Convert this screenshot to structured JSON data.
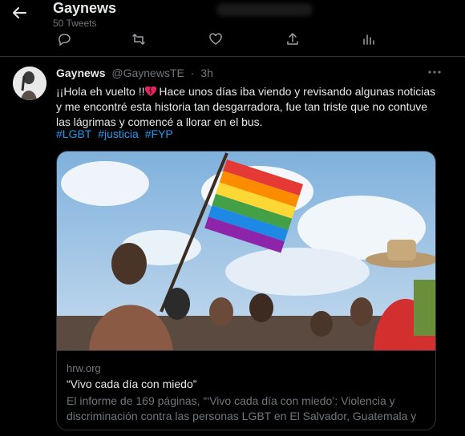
{
  "header": {
    "title": "Gaynews",
    "tweet_count": "50 Tweets"
  },
  "icons": {
    "back": "arrow-left-icon",
    "reply": "reply-icon",
    "retweet": "retweet-icon",
    "like": "heart-icon",
    "share": "share-icon",
    "analytics": "analytics-icon",
    "more": "more-icon"
  },
  "tweet": {
    "author_name": "Gaynews",
    "author_handle": "@GaynewsTE",
    "separator": "·",
    "time": "3h",
    "text_before_emoji": "¡¡Hola eh vuelto !!",
    "text_after_emoji": " Hace unos días iba viendo y revisando algunas noticias y me encontré esta historia tan desgarradora, fue tan triste que no contuve las lágrimas y comencé a llorar en el bus.",
    "hashtags": [
      "#LGBT",
      "#justicia",
      "#FYP"
    ]
  },
  "card": {
    "domain": "hrw.org",
    "title": "“Vivo cada día con miedo”",
    "description": "El informe de 169 páginas, “‘Vivo cada día con miedo’: Violencia y discriminación contra las personas LGBT en El Salvador, Guatemala y ..."
  },
  "colors": {
    "background": "#000000",
    "text": "#e7e9ea",
    "muted": "#71767b",
    "link": "#1d9bf0",
    "border": "#2f3336"
  }
}
